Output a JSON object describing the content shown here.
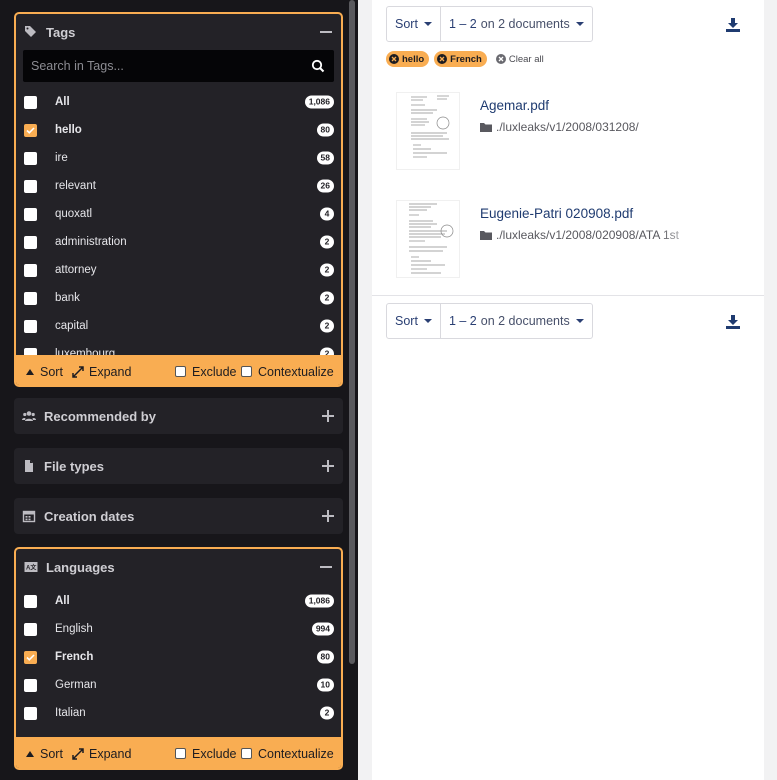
{
  "sidebar": {
    "tags": {
      "title": "Tags",
      "search_placeholder": "Search in Tags...",
      "items": [
        {
          "label": "All",
          "count": "1,086",
          "checked": false
        },
        {
          "label": "hello",
          "count": "80",
          "checked": true
        },
        {
          "label": "ire",
          "count": "58",
          "checked": false
        },
        {
          "label": "relevant",
          "count": "26",
          "checked": false
        },
        {
          "label": "quoxatl",
          "count": "4",
          "checked": false
        },
        {
          "label": "administration",
          "count": "2",
          "checked": false
        },
        {
          "label": "attorney",
          "count": "2",
          "checked": false
        },
        {
          "label": "bank",
          "count": "2",
          "checked": false
        },
        {
          "label": "capital",
          "count": "2",
          "checked": false
        },
        {
          "label": "luxembourg",
          "count": "2",
          "checked": false
        }
      ],
      "footer": {
        "sort": "Sort",
        "expand": "Expand",
        "exclude": "Exclude",
        "contextualize": "Contextualize"
      }
    },
    "recommended": {
      "title": "Recommended by"
    },
    "file_types": {
      "title": "File types"
    },
    "creation_dates": {
      "title": "Creation dates"
    },
    "languages": {
      "title": "Languages",
      "items": [
        {
          "label": "All",
          "count": "1,086",
          "checked": false
        },
        {
          "label": "English",
          "count": "994",
          "checked": false
        },
        {
          "label": "French",
          "count": "80",
          "checked": true
        },
        {
          "label": "German",
          "count": "10",
          "checked": false
        },
        {
          "label": "Italian",
          "count": "2",
          "checked": false
        }
      ],
      "footer": {
        "sort": "Sort",
        "expand": "Expand",
        "exclude": "Exclude",
        "contextualize": "Contextualize"
      }
    }
  },
  "main": {
    "toolbar_top": {
      "sort": "Sort",
      "range": "1 – 2",
      "range_suffix": "on 2 documents"
    },
    "toolbar_bottom": {
      "sort": "Sort",
      "range": "1 – 2",
      "range_suffix": "on 2 documents"
    },
    "chips": [
      {
        "label": "hello"
      },
      {
        "label": "French"
      }
    ],
    "clear_all": "Clear all",
    "documents": [
      {
        "title": "Agemar.pdf",
        "path": "./luxleaks/v1/2008/031208/"
      },
      {
        "title": "Eugenie-Patri 020908.pdf",
        "path": "./luxleaks/v1/2008/020908/ATA 1st"
      }
    ]
  },
  "colors": {
    "accent": "#f9ad52",
    "sidebar_bg": "#17161a",
    "panel_bg": "#232227",
    "link": "#1f3b70"
  },
  "icons": {
    "tags": "tags-icon",
    "search": "search-icon",
    "minus": "minus-icon",
    "plus": "plus-icon",
    "users": "users-icon",
    "file": "file-icon",
    "calendar": "calendar-icon",
    "language": "language-icon",
    "sort": "sort-up-icon",
    "expand": "expand-icon",
    "download": "download-icon",
    "folder": "folder-icon",
    "close": "close-circle-icon"
  }
}
